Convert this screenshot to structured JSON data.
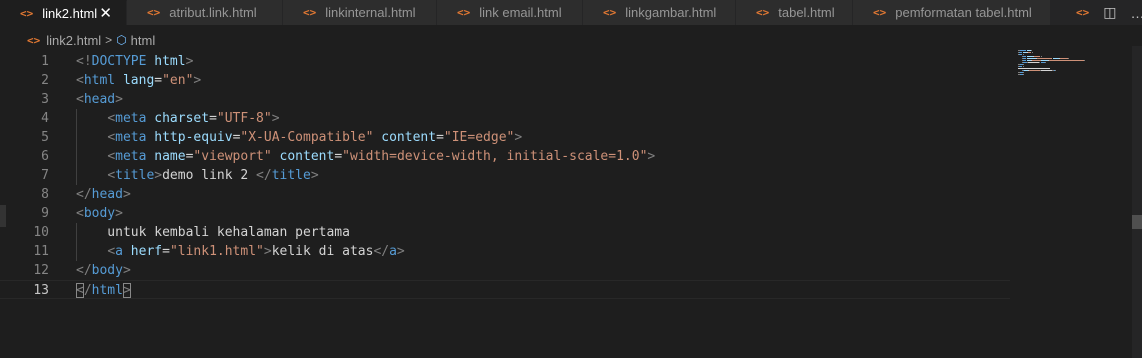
{
  "tabs": [
    {
      "label": "link2.html",
      "active": true,
      "close": "✕",
      "width": 127
    },
    {
      "label": "atribut.link.html",
      "active": false,
      "width": 156
    },
    {
      "label": "linkinternal.html",
      "active": false,
      "width": 154
    },
    {
      "label": "link email.html",
      "active": false,
      "width": 146
    },
    {
      "label": "linkgambar.html",
      "active": false,
      "width": 153
    },
    {
      "label": "tabel.html",
      "active": false,
      "width": 117
    },
    {
      "label": "pemformatan tabel.html",
      "active": false,
      "width": 198
    }
  ],
  "tab_icon": "<>",
  "tab_actions": {
    "overflow": "<>",
    "split": "◫",
    "more": "…"
  },
  "breadcrumb": {
    "file": "link2.html",
    "separator": ">",
    "symbol": "html"
  },
  "lines": [
    [
      [
        "punct",
        "<!"
      ],
      [
        "tag",
        "DOCTYPE"
      ],
      [
        "txt",
        " "
      ],
      [
        "attr",
        "html"
      ],
      [
        "punct",
        ">"
      ]
    ],
    [
      [
        "punct",
        "<"
      ],
      [
        "tag",
        "html"
      ],
      [
        "txt",
        " "
      ],
      [
        "attr",
        "lang"
      ],
      [
        "txt",
        "="
      ],
      [
        "str",
        "\"en\""
      ],
      [
        "punct",
        ">"
      ]
    ],
    [
      [
        "punct",
        "<"
      ],
      [
        "tag",
        "head"
      ],
      [
        "punct",
        ">"
      ]
    ],
    [
      [
        "txt",
        "    "
      ],
      [
        "punct",
        "<"
      ],
      [
        "tag",
        "meta"
      ],
      [
        "txt",
        " "
      ],
      [
        "attr",
        "charset"
      ],
      [
        "txt",
        "="
      ],
      [
        "str",
        "\"UTF-8\""
      ],
      [
        "punct",
        ">"
      ]
    ],
    [
      [
        "txt",
        "    "
      ],
      [
        "punct",
        "<"
      ],
      [
        "tag",
        "meta"
      ],
      [
        "txt",
        " "
      ],
      [
        "attr",
        "http-equiv"
      ],
      [
        "txt",
        "="
      ],
      [
        "str",
        "\"X-UA-Compatible\""
      ],
      [
        "txt",
        " "
      ],
      [
        "attr",
        "content"
      ],
      [
        "txt",
        "="
      ],
      [
        "str",
        "\"IE=edge\""
      ],
      [
        "punct",
        ">"
      ]
    ],
    [
      [
        "txt",
        "    "
      ],
      [
        "punct",
        "<"
      ],
      [
        "tag",
        "meta"
      ],
      [
        "txt",
        " "
      ],
      [
        "attr",
        "name"
      ],
      [
        "txt",
        "="
      ],
      [
        "str",
        "\"viewport\""
      ],
      [
        "txt",
        " "
      ],
      [
        "attr",
        "content"
      ],
      [
        "txt",
        "="
      ],
      [
        "str",
        "\"width=device-width, initial-scale=1.0\""
      ],
      [
        "punct",
        ">"
      ]
    ],
    [
      [
        "txt",
        "    "
      ],
      [
        "punct",
        "<"
      ],
      [
        "tag",
        "title"
      ],
      [
        "punct",
        ">"
      ],
      [
        "txt",
        "demo link 2 "
      ],
      [
        "punct",
        "</"
      ],
      [
        "tag",
        "title"
      ],
      [
        "punct",
        ">"
      ]
    ],
    [
      [
        "punct",
        "</"
      ],
      [
        "tag",
        "head"
      ],
      [
        "punct",
        ">"
      ]
    ],
    [
      [
        "punct",
        "<"
      ],
      [
        "tag",
        "body"
      ],
      [
        "punct",
        ">"
      ]
    ],
    [
      [
        "txt",
        "    untuk kembali kehalaman pertama"
      ]
    ],
    [
      [
        "txt",
        "    "
      ],
      [
        "punct",
        "<"
      ],
      [
        "tag",
        "a"
      ],
      [
        "txt",
        " "
      ],
      [
        "attr",
        "herf"
      ],
      [
        "txt",
        "="
      ],
      [
        "str",
        "\"link1.html\""
      ],
      [
        "punct",
        ">"
      ],
      [
        "txt",
        "kelik di atas"
      ],
      [
        "punct",
        "</"
      ],
      [
        "tag",
        "a"
      ],
      [
        "punct",
        ">"
      ]
    ],
    [
      [
        "punct",
        "</"
      ],
      [
        "tag",
        "body"
      ],
      [
        "punct",
        ">"
      ]
    ],
    [
      [
        "bracket",
        "<"
      ],
      [
        "punct",
        "/"
      ],
      [
        "tag",
        "html"
      ],
      [
        "bracket",
        ">"
      ]
    ]
  ],
  "current_line": 13,
  "colors": {
    "tag": "#569cd6",
    "punct": "#808080",
    "attr": "#9cdcfe",
    "str": "#ce9178",
    "txt": "#d4d4d4",
    "bracket": "#808080",
    "icon_orange": "#e37933"
  }
}
